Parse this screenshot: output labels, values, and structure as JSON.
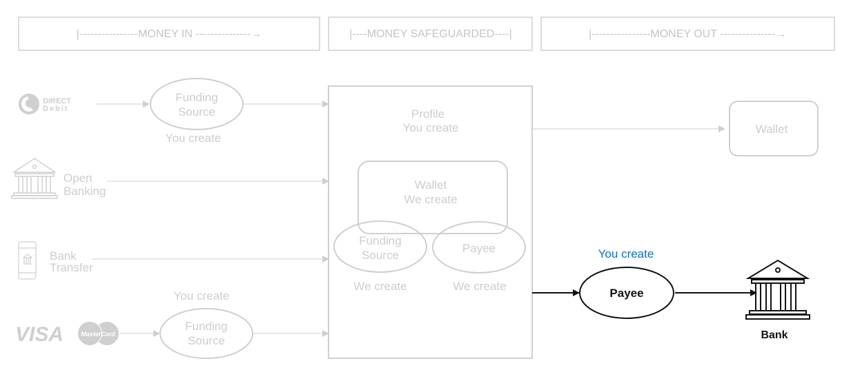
{
  "colors": {
    "inactive": "#cdcdcd",
    "active": "#111111",
    "accent": "#0a72c4"
  },
  "headers": [
    "|----------------MONEY IN ---------------→",
    "|----MONEY SAFEGUARDED----|",
    "|----------------MONEY OUT ---------------→"
  ],
  "sources": {
    "direct_debit": {
      "logo_line1": "DIRECT",
      "logo_line2": "Debit",
      "icon": "direct-debit-logo"
    },
    "open_banking": {
      "line1": "Open",
      "line2": "Banking",
      "icon": "bank-icon"
    },
    "bank_transfer": {
      "line1": "Bank",
      "line2": "Transfer",
      "icon": "mobile-bank-icon"
    },
    "cards": {
      "visa": "VISA",
      "mastercard": "MasterCard",
      "icon": "card-logos"
    }
  },
  "funding_top": {
    "line1": "Funding",
    "line2": "Source",
    "caption": "You create"
  },
  "funding_bottom": {
    "line1": "Funding",
    "line2": "Source",
    "caption": "You create"
  },
  "profile": {
    "line1": "Profile",
    "line2": "You create"
  },
  "inner_wallet": {
    "line1": "Wallet",
    "line2": "We create"
  },
  "inner_funding": {
    "line1": "Funding",
    "line2": "Source",
    "caption": "We create"
  },
  "inner_payee": {
    "label": "Payee",
    "caption": "We create"
  },
  "out_wallet": {
    "label": "Wallet"
  },
  "out_payee": {
    "label": "Payee",
    "caption": "You create"
  },
  "bank": {
    "label": "Bank",
    "icon": "bank-icon"
  }
}
